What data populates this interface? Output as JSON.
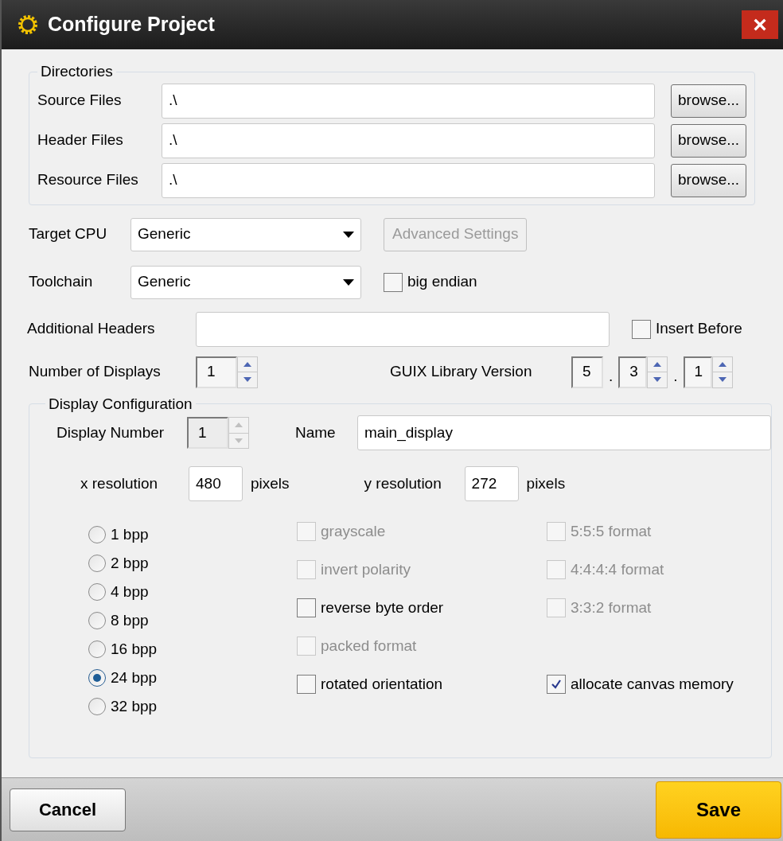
{
  "window": {
    "title": "Configure Project",
    "close": "×"
  },
  "directories": {
    "title": "Directories",
    "rows": [
      {
        "label": "Source Files",
        "value": ".\\",
        "button": "browse..."
      },
      {
        "label": "Header Files",
        "value": ".\\",
        "button": "browse..."
      },
      {
        "label": "Resource Files",
        "value": ".\\",
        "button": "browse..."
      }
    ]
  },
  "target_cpu": {
    "label": "Target CPU",
    "value": "Generic"
  },
  "advanced_settings": {
    "label": "Advanced Settings",
    "disabled": true
  },
  "toolchain": {
    "label": "Toolchain",
    "value": "Generic"
  },
  "big_endian": {
    "label": "big endian",
    "checked": false
  },
  "additional_headers": {
    "label": "Additional Headers"
  },
  "insert_before": {
    "label": "Insert Before",
    "checked": false
  },
  "number_of_displays": {
    "label": "Number of Displays",
    "value": "1",
    "disabled": false
  },
  "library_version": {
    "label": "GUIX Library Version",
    "parts": [
      {
        "value": "5",
        "spinner": false
      },
      {
        "separator": ".",
        "value": "3",
        "spinner": true
      },
      {
        "separator": ".",
        "value": "1",
        "spinner": true
      }
    ]
  },
  "display_configuration": {
    "title": "Display Configuration",
    "display_number": {
      "label": "Display Number",
      "value": "1",
      "disabled": true
    },
    "name": {
      "label": "Name",
      "value": "main_display"
    },
    "x_resolution": {
      "label": "x resolution",
      "value": "480",
      "unit": "pixels"
    },
    "y_resolution": {
      "label": "y resolution",
      "value": "272",
      "unit": "pixels"
    },
    "bpp": [
      {
        "label": "1 bpp",
        "selected": false
      },
      {
        "label": "2 bpp",
        "selected": false
      },
      {
        "label": "4 bpp",
        "selected": false
      },
      {
        "label": "8 bpp",
        "selected": false
      },
      {
        "label": "16 bpp",
        "selected": false
      },
      {
        "label": "24 bpp",
        "selected": true
      },
      {
        "label": "32 bpp",
        "selected": false
      }
    ],
    "option_rows": [
      {
        "left": {
          "label": "grayscale",
          "checked": false,
          "disabled": true
        },
        "right": {
          "label": "5:5:5 format",
          "checked": false,
          "disabled": true
        }
      },
      {
        "left": {
          "label": "invert polarity",
          "checked": false,
          "disabled": true
        },
        "right": {
          "label": "4:4:4:4 format",
          "checked": false,
          "disabled": true
        }
      },
      {
        "left": {
          "label": "reverse byte order",
          "checked": false,
          "disabled": false
        },
        "right": {
          "label": "3:3:2 format",
          "checked": false,
          "disabled": true
        }
      },
      {
        "left": {
          "label": "packed format",
          "checked": false,
          "disabled": true
        }
      },
      {
        "left": {
          "label": "rotated orientation",
          "checked": false,
          "disabled": false
        },
        "right": {
          "label": "allocate canvas memory",
          "checked": true,
          "disabled": false
        }
      }
    ]
  },
  "footer": {
    "cancel": "Cancel",
    "save": "Save"
  }
}
